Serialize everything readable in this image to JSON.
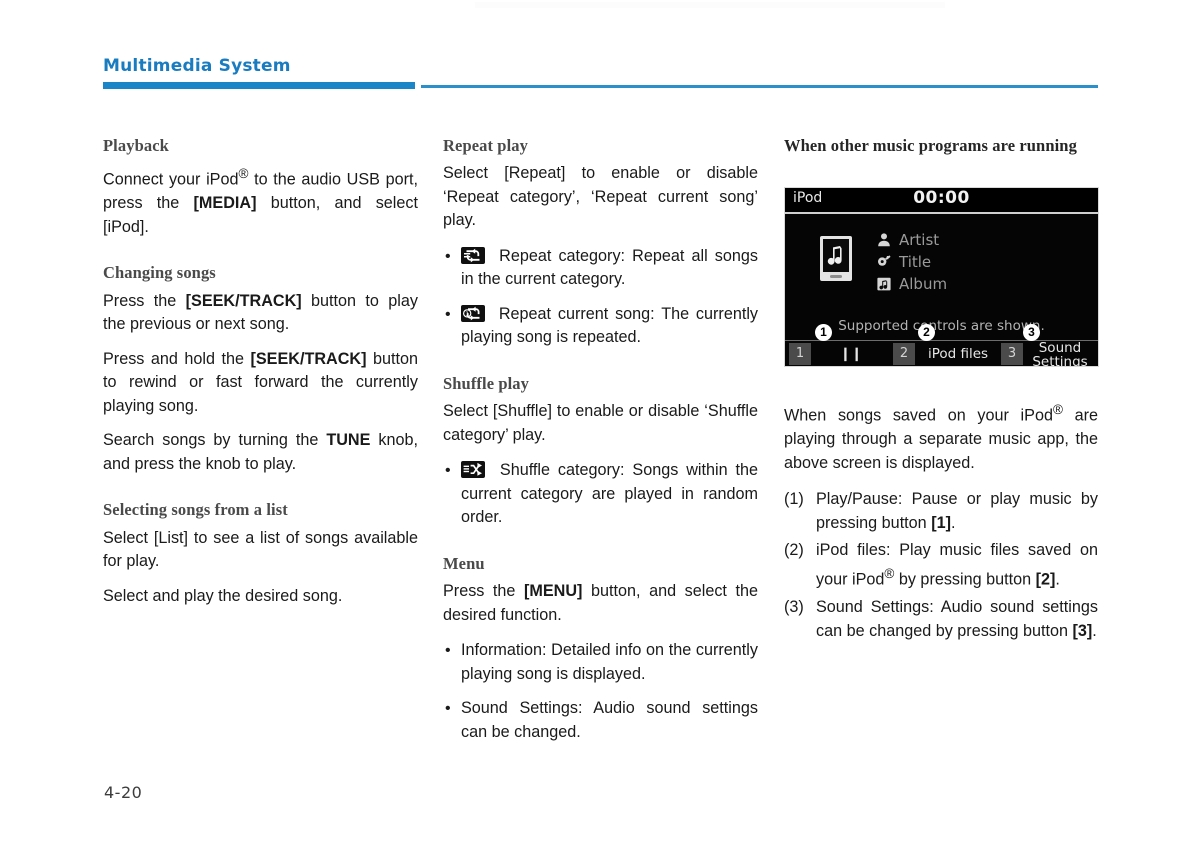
{
  "header": {
    "chapter_title": "Multimedia System",
    "accent_color": "#1a86c8"
  },
  "folio": "4-20",
  "column1": {
    "playback": {
      "heading": "Playback",
      "paragraphs": [
        "Connect your iPod® to the audio USB port, press the [MEDIA] button, and select [iPod]."
      ]
    },
    "changing_songs": {
      "heading": "Changing songs",
      "p1": "Press the [SEEK/TRACK] button to play the previous or next song.",
      "p2": "Press and hold the [SEEK/TRACK] button to rewind or fast forward the currently playing song.",
      "p3": "Search songs by turning the TUNE knob, and press the knob to play."
    },
    "selecting_songs": {
      "heading": "Selecting songs from a list",
      "p1": "Select [List] to see a list of songs available for play.",
      "p2": "Select and play the desired song."
    }
  },
  "column2": {
    "repeat_play": {
      "heading": "Repeat play",
      "intro": "Select [Repeat] to enable or disable ‘Repeat category’, ‘Repeat current song’ play.",
      "items": [
        {
          "icon": "repeat-category-icon",
          "text": "Repeat category: Repeat all songs in the current category."
        },
        {
          "icon": "repeat-one-icon",
          "text": "Repeat current song: The currently playing song is repeated."
        }
      ]
    },
    "shuffle_play": {
      "heading": "Shuffle play",
      "intro": "Select [Shuffle] to enable or disable ‘Shuffle category’ play.",
      "items": [
        {
          "icon": "shuffle-category-icon",
          "text": "Shuffle category: Songs within the current category are played in random order."
        }
      ]
    },
    "menu": {
      "heading": "Menu",
      "intro": "Press the [MENU] button, and select the desired function.",
      "items": [
        "Information: Detailed info on the currently playing song is displayed.",
        "Sound Settings: Audio sound settings can be changed."
      ]
    }
  },
  "column3": {
    "heading": "When other music programs are running",
    "screen": {
      "source": "iPod",
      "clock": "00:00",
      "meta": [
        {
          "icon": "person-icon",
          "label": "Artist"
        },
        {
          "icon": "note-tag-icon",
          "label": "Title"
        },
        {
          "icon": "album-icon",
          "label": "Album"
        }
      ],
      "supported_note": "Supported controls are shown.",
      "toolbar": [
        {
          "key": "1",
          "label": "❙❙",
          "callout": "①"
        },
        {
          "key": "2",
          "label": "iPod files",
          "callout": "②"
        },
        {
          "key": "3",
          "label": "Sound Settings",
          "callout": "③"
        }
      ]
    },
    "intro": "When songs saved on your iPod® are playing through a separate music app, the above screen is displayed.",
    "numbered": [
      {
        "num": "(1)",
        "text": "Play/Pause: Pause or play music by pressing button [1]."
      },
      {
        "num": "(2)",
        "text": "iPod files: Play music files saved on your iPod® by pressing button [2]."
      },
      {
        "num": "(3)",
        "text": "Sound Settings: Audio sound settings can be changed by pressing button [3]."
      }
    ]
  }
}
